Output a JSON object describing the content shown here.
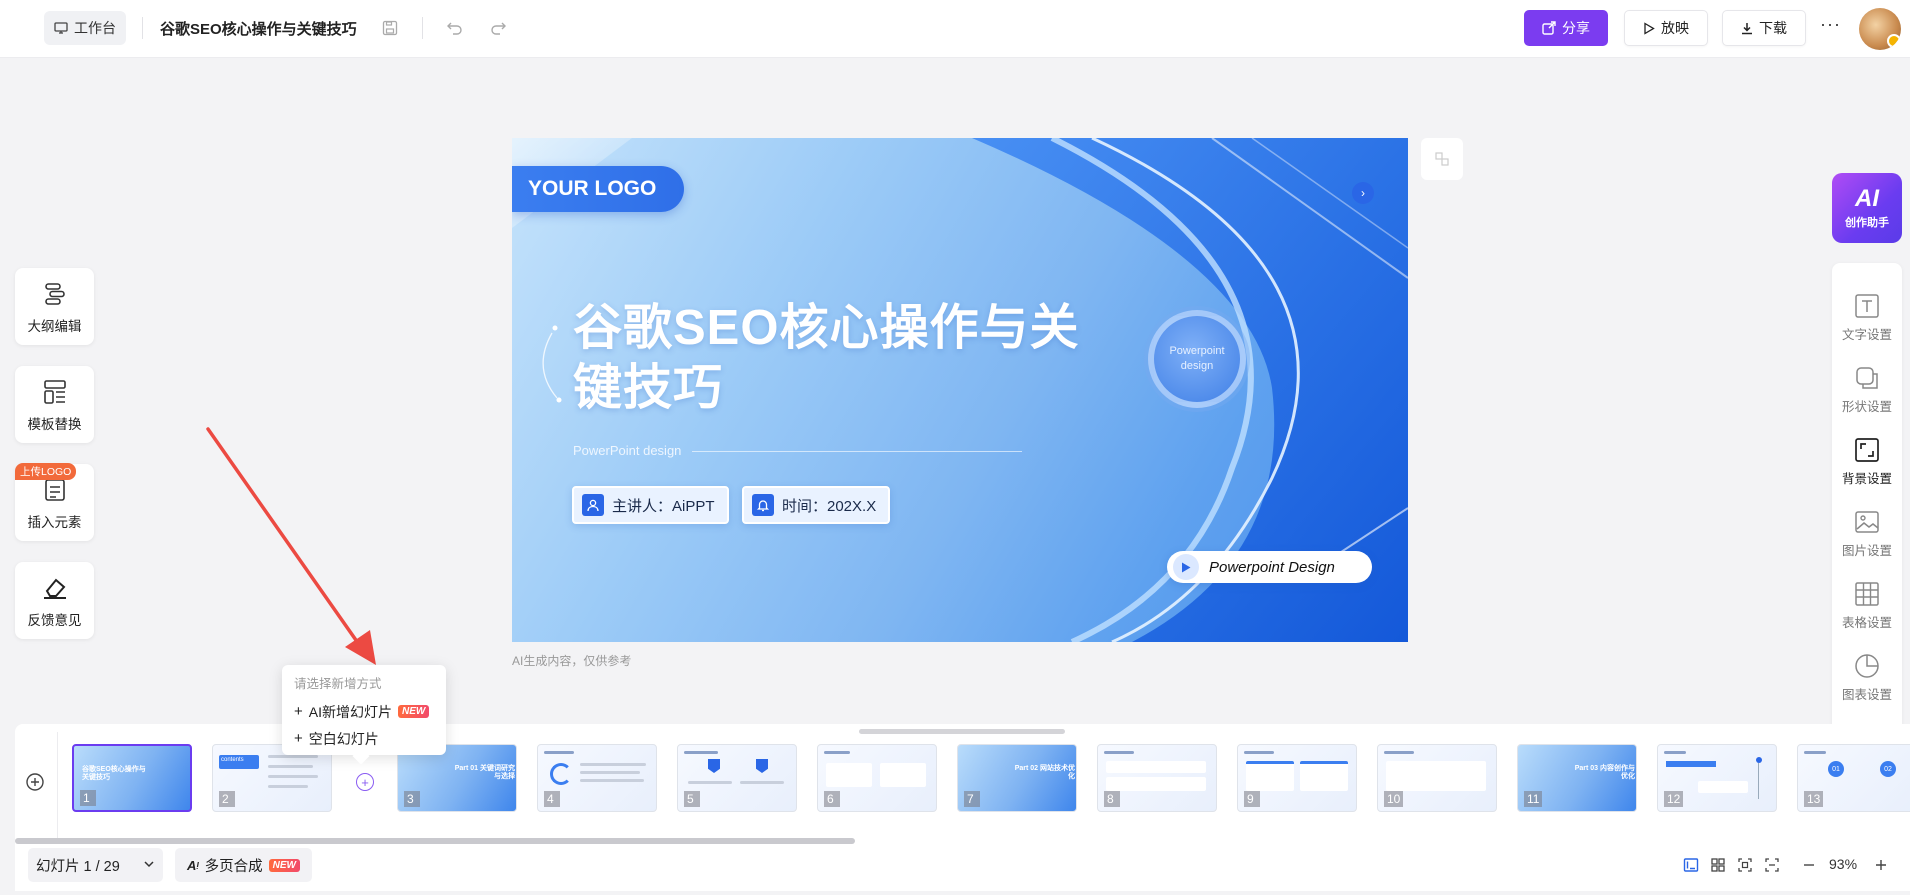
{
  "header": {
    "workbench_label": "工作台",
    "doc_title": "谷歌SEO核心操作与关键技巧",
    "share_label": "分享",
    "present_label": "放映",
    "download_label": "下载",
    "more_label": "···"
  },
  "left_tools": {
    "outline": "大纲编辑",
    "template": "模板替换",
    "insert": "插入元素",
    "insert_badge": "上传LOGO",
    "feedback": "反馈意见"
  },
  "slide": {
    "logo": "YOUR LOGO",
    "title": "谷歌SEO核心操作与关键技巧",
    "subtitle": "PowerPoint design",
    "presenter": "主讲人：AiPPT",
    "time": "时间：202X.X",
    "circle_text": "Powerpoint design",
    "pd_label": "Powerpoint Design",
    "ai_note": "AI生成内容，仅供参考"
  },
  "right_panel": {
    "ai_big": "AI",
    "ai_small": "创作助手",
    "items": [
      "文字设置",
      "形状设置",
      "背景设置",
      "图片设置",
      "表格设置",
      "图表设置"
    ]
  },
  "popup": {
    "header": "请选择新增方式",
    "ai_add": "AI新增幻灯片",
    "new_tag": "NEW",
    "blank_add": "空白幻灯片"
  },
  "filmstrip": {
    "thumbs": [
      {
        "num": "1",
        "title": "谷歌SEO核心操作与关键技巧"
      },
      {
        "num": "2",
        "title": "contents"
      },
      {
        "num": "3",
        "title": "Part 01 关键词研究与选择"
      },
      {
        "num": "4",
        "title": ""
      },
      {
        "num": "5",
        "title": ""
      },
      {
        "num": "6",
        "title": ""
      },
      {
        "num": "7",
        "title": "Part 02 网站技术优化"
      },
      {
        "num": "8",
        "title": ""
      },
      {
        "num": "9",
        "title": ""
      },
      {
        "num": "10",
        "title": ""
      },
      {
        "num": "11",
        "title": "Part 03 内容创作与优化"
      },
      {
        "num": "12",
        "title": ""
      },
      {
        "num": "13",
        "title": ""
      }
    ]
  },
  "bottom": {
    "slide_count": "幻灯片 1 / 29",
    "multi_label": "多页合成",
    "new_tag": "NEW",
    "zoom": "93%"
  },
  "colors": {
    "accent": "#7b3cf0",
    "slide_blue": "#2f6fe8",
    "new_tag": "#f24a6a"
  }
}
